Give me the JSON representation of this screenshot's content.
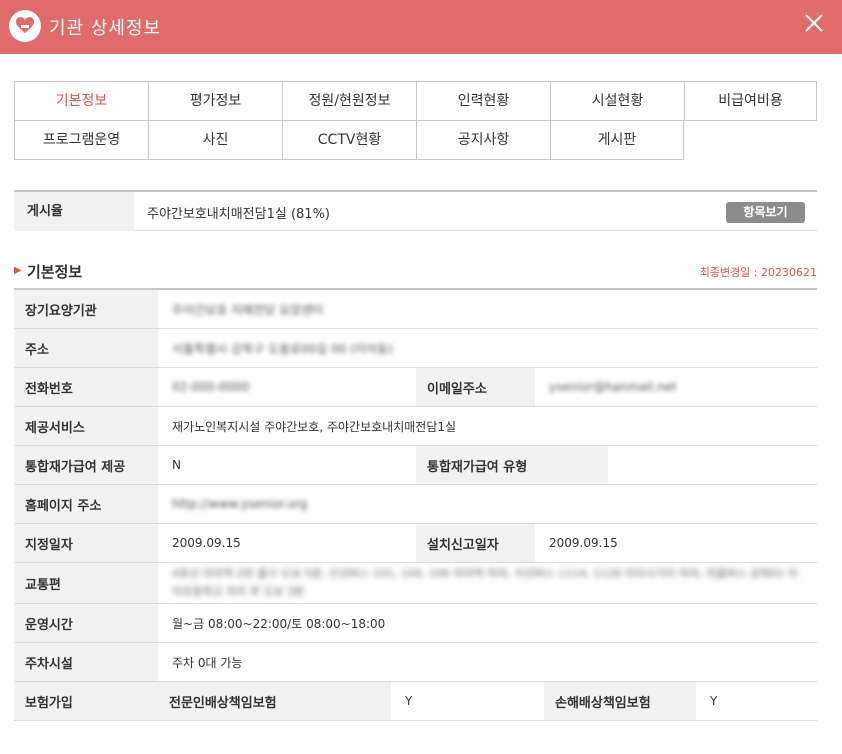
{
  "window": {
    "title": "기관 상세정보"
  },
  "tabs": [
    {
      "label": "기본정보",
      "active": true
    },
    {
      "label": "평가정보"
    },
    {
      "label": "정원/현원정보"
    },
    {
      "label": "인력현황"
    },
    {
      "label": "시설현황"
    },
    {
      "label": "비급여비용"
    },
    {
      "label": "프로그램운영"
    },
    {
      "label": "사진"
    },
    {
      "label": "CCTV현황"
    },
    {
      "label": "공지사항"
    },
    {
      "label": "게시판"
    }
  ],
  "posting": {
    "label": "게시율",
    "value": "주야간보호내치매전담1실 (81%)",
    "button": "항목보기"
  },
  "section": {
    "title": "기본정보",
    "updated": "최종변경일 : 20230621"
  },
  "info": {
    "agency_label": "장기요양기관",
    "agency_value": "주야간보호 치매전담 요양센터",
    "address_label": "주소",
    "address_value": "서울특별시 강북구 도봉로00길 00 (미아동)",
    "phone_label": "전화번호",
    "phone_value": "02-000-0000",
    "email_label": "이메일주소",
    "email_value": "ysenior@hanmail.net",
    "service_label": "제공서비스",
    "service_value": "재가노인복지시설 주야간보호, 주야간보호내치매전담1실",
    "integrated_label": "통합재가급여 제공",
    "integrated_value": "N",
    "integrated_type_label": "통합재가급여 유형",
    "homepage_label": "홈페이지 주소",
    "homepage_value": "http://www.ysenior.org",
    "designation_label": "지정일자",
    "designation_value": "2009.09.15",
    "install_label": "설치신고일자",
    "install_value": "2009.09.15",
    "transport_label": "교통편",
    "transport_value": "4호선 미아역 2번 출구 도보 5분, 간선버스 101, 104, 106 미아역 하차, 지선버스 1114, 1128 미아사거리 하차, 마을버스 강북01 미아초등학교 하차 후 도보 3분",
    "hours_label": "운영시간",
    "hours_value": "월~금 08:00~22:00/토 08:00~18:00",
    "parking_label": "주차시설",
    "parking_value": "주차 0대 가능",
    "insurance_label": "보험가입",
    "liability_label": "전문인배상책임보험",
    "liability_value": "Y",
    "damage_label": "손해배상책임보험",
    "damage_value": "Y"
  },
  "colors": {
    "header": "#e06b6b",
    "accent": "#d9534f",
    "label_bg": "#f2f2f2",
    "button": "#8c8c8c"
  },
  "icons": {
    "app": "heart-hand-icon",
    "close": "close-icon",
    "section": "triangle-right-icon"
  }
}
